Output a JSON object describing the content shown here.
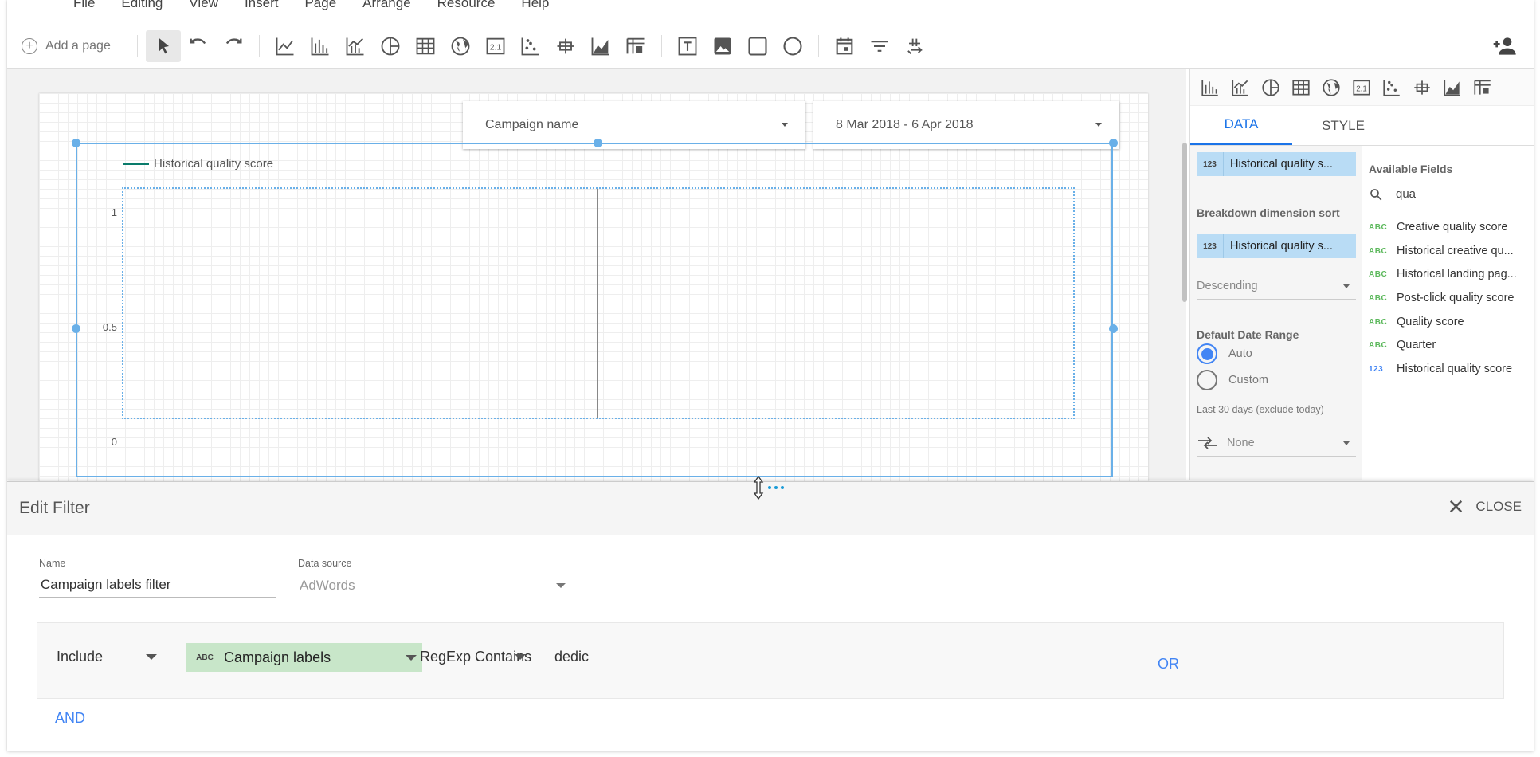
{
  "menu": {
    "items": [
      "File",
      "Editing",
      "View",
      "Insert",
      "Page",
      "Arrange",
      "Resource",
      "Help"
    ]
  },
  "toolbar": {
    "add_page_label": "Add a page",
    "tools": [
      "pointer-icon",
      "undo-icon",
      "redo-icon",
      "time-series-icon",
      "bar-chart-icon",
      "combo-chart-icon",
      "pie-chart-icon",
      "table-icon",
      "geo-map-icon",
      "scorecard-icon",
      "scatter-chart-icon",
      "bullet-chart-icon",
      "area-chart-icon",
      "pivot-table-icon",
      "text-icon",
      "image-icon",
      "rectangle-icon",
      "circle-icon",
      "date-range-icon",
      "filter-control-icon",
      "data-control-icon"
    ]
  },
  "canvas": {
    "campaign_control": "Campaign name",
    "date_control": "8 Mar 2018 - 6 Apr 2018",
    "legend_series": "Historical quality score",
    "y_ticks": [
      "1",
      "0.5",
      "0"
    ]
  },
  "chart_data": {
    "type": "line",
    "series": [
      {
        "name": "Historical quality score",
        "values": []
      }
    ],
    "ylim": [
      0,
      1
    ],
    "y_ticks": [
      0,
      0.5,
      1
    ],
    "legend_position": "top-left"
  },
  "panel": {
    "tabs": {
      "data": "DATA",
      "style": "STYLE"
    },
    "metric_chip": {
      "type": "123",
      "label": "Historical quality s..."
    },
    "breakdown_sort_title": "Breakdown dimension sort",
    "sort_chip": {
      "type": "123",
      "label": "Historical quality s..."
    },
    "sort_order": "Descending",
    "date_range_title": "Default Date Range",
    "radio_auto": "Auto",
    "radio_custom": "Custom",
    "date_hint": "Last 30 days (exclude today)",
    "comparison": "None",
    "available_fields_title": "Available Fields",
    "search_value": "qua",
    "fields": [
      {
        "type": "ABC",
        "name": "Creative quality score"
      },
      {
        "type": "ABC",
        "name": "Historical creative qu..."
      },
      {
        "type": "ABC",
        "name": "Historical landing pag..."
      },
      {
        "type": "ABC",
        "name": "Post-click quality score"
      },
      {
        "type": "ABC",
        "name": "Quality score"
      },
      {
        "type": "ABC",
        "name": "Quarter"
      },
      {
        "type": "123",
        "name": "Historical quality score"
      }
    ]
  },
  "filter": {
    "title": "Edit Filter",
    "close_label": "CLOSE",
    "name_label": "Name",
    "name_value": "Campaign labels filter",
    "source_label": "Data source",
    "source_value": "AdWords",
    "include": "Include",
    "field_type": "ABC",
    "field_name": "Campaign labels",
    "operator": "RegExp Contains",
    "value": "dedic",
    "or_label": "OR",
    "and_label": "AND"
  },
  "colors": {
    "accent": "#4285f4",
    "selection": "#6ab0e8",
    "series": "#0a7b6b",
    "chip_blue": "#b9dcf5",
    "chip_green": "#c8e6c9"
  }
}
